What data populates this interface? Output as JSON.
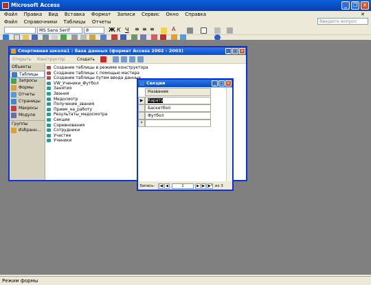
{
  "app": {
    "title": "Microsoft Access"
  },
  "menu": [
    "Файл",
    "Правка",
    "Вид",
    "Вставка",
    "Формат",
    "Записи",
    "Сервис",
    "Окно",
    "Справка"
  ],
  "menu2": [
    "Файл",
    "Справочники",
    "Таблицы",
    "Отчеты"
  ],
  "help_placeholder": "Введите вопрос",
  "format": {
    "font": "MS Sans Serif",
    "size": "8"
  },
  "db_window": {
    "title": "Спортивная школа1 : база данных (формат Access 2002 - 2003)",
    "toolbar": {
      "open": "Открыть",
      "design": "Конструктор",
      "create": "Создать"
    },
    "sidebar": {
      "objects_header": "Объекты",
      "items": [
        "Таблицы",
        "Запросы",
        "Формы",
        "Отчеты",
        "Страницы",
        "Макросы",
        "Модули"
      ],
      "groups_header": "Группы",
      "groups": [
        "Избранн..."
      ]
    },
    "objects": [
      "Создание таблицы в режиме конструктора",
      "Создание таблицы с помощью мастера",
      "Создание таблицы путем ввода данных",
      "VW_Ученики_Футбол",
      "Занятия",
      "Звания",
      "Медосмотр",
      "Получение_звания",
      "Прием_на_работу",
      "Результаты_медосмотра",
      "Секции",
      "Соревнования",
      "Сотрудники",
      "Участие",
      "Ученики"
    ]
  },
  "table_window": {
    "title": "Секции",
    "column": "Название",
    "rows": [
      "Каратэ",
      "Баскетбол",
      "Футбол"
    ],
    "new_row_marker": "*",
    "nav": {
      "label": "Запись:",
      "current": "1",
      "of_label": "из 3"
    }
  },
  "status": {
    "text": "Режим формы"
  }
}
